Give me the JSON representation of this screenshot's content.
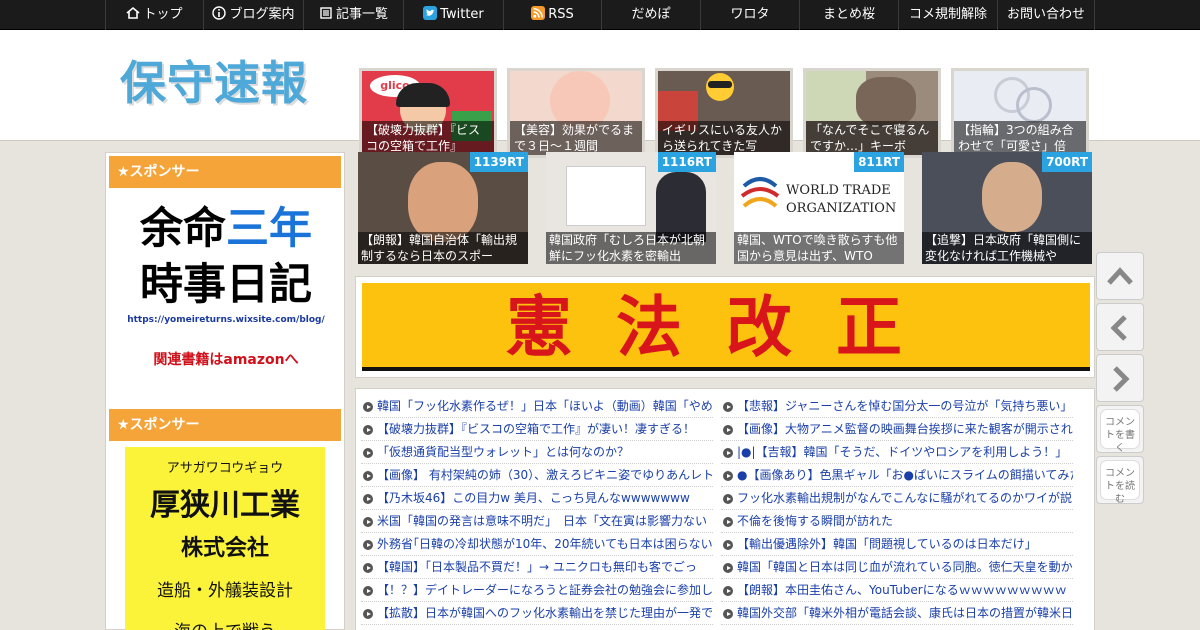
{
  "nav": {
    "items": [
      {
        "label": "トップ",
        "icon": "home-icon"
      },
      {
        "label": "ブログ案内",
        "icon": "info-icon"
      },
      {
        "label": "記事一覧",
        "icon": "list-icon"
      },
      {
        "label": "Twitter",
        "icon": "twitter-icon"
      },
      {
        "label": "RSS",
        "icon": "rss-icon"
      },
      {
        "label": "だめぽ",
        "icon": ""
      },
      {
        "label": "ワロタ",
        "icon": ""
      },
      {
        "label": "まとめ桜",
        "icon": ""
      },
      {
        "label": "コメ規制解除",
        "icon": ""
      },
      {
        "label": "お問い合わせ",
        "icon": ""
      }
    ]
  },
  "header": {
    "logo": "保守速報",
    "thumbs": [
      {
        "text": "【破壊力抜群】『ビスコの空箱で工作』",
        "extra": "glico"
      },
      {
        "text": "【美容】効果がでるまで３日～１週間",
        "extra": ""
      },
      {
        "text": "イギリスにいる友人から送られてきた写",
        "extra": ""
      },
      {
        "text": "「なんでそこで寝るんですか…」キーボ",
        "extra": ""
      },
      {
        "text": "【指輪】3つの組み合わせで「可愛さ」倍",
        "extra": ""
      }
    ]
  },
  "sidebar": {
    "sponsor_label_1": "★スポンサー",
    "ad1_line1_black": "余命",
    "ad1_line1_blue": "三年",
    "ad1_line2": "時事日記",
    "ad1_url": "https://yomeireturns.wixsite.com/blog/",
    "ad1_amazon": "関連書籍はamazonへ",
    "sponsor_label_2": "★スポンサー",
    "ad2_kana": "アサガワコウギョウ",
    "ad2_name": "厚狭川工業",
    "ad2_company": "株式会社",
    "ad2_service": "造船・外艤装設計",
    "ad2_tail": "海の上で戦う"
  },
  "rt_items": [
    {
      "count": "1139RT",
      "text": "【朗報】韓国自治体「輸出規制するなら日本のスポー"
    },
    {
      "count": "1116RT",
      "text": "韓国政府「むしろ日本が北朝鮮にフッ化水素を密輸出"
    },
    {
      "count": "811RT",
      "text": "韓国、WTOで喚き散らすも他国から意見は出ず、WTO",
      "logo_line1": "WORLD TRADE",
      "logo_line2": "ORGANIZATION"
    },
    {
      "count": "700RT",
      "text": "【追撃】日本政府「韓国側に変化なければ工作機械や"
    }
  ],
  "banner": {
    "text": "憲法改正"
  },
  "list_left": [
    "韓国「フッ化水素作るぜ！」日本「ほいよ（動画）韓国「やめ",
    "【破壊力抜群】『ビスコの空箱で工作』が凄い！凄すぎる！",
    "「仮想通貨配当型ウォレット」とは何なのか？",
    "【画像】 有村架純の姉（30）、激えろビキニ姿でゆりあんレト",
    "【乃木坂46】この目力w 美月、こっち見んなwwwwwww",
    "米国「韓国の発言は意味不明だ」　日本「文在寅は影響力ない",
    "外務省｢日韓の冷却状態が10年、20年続いても日本は困らない」",
    "【韓国】「日本製品不買だ！」→ ユニクロも無印も客でごっ",
    "【！？】デイトレーダーになろうと証券会社の勉強会に参加し",
    "【拡散】日本が韓国へのフッ化水素輸出を禁じた理由が一発で"
  ],
  "list_right": [
    "【悲報】ジャニーさんを悼む国分太一の号泣が「気持ち悪い」",
    "【画像】大物アニメ監督の映画舞台挨拶に来た観客が開示され",
    "|●|【吉報】韓国「そうだ、ドイツやロシアを利用しよう！」",
    "●【画像あり】色黒ギャル「お●ぱいにスライムの餌描いてみた",
    "フッ化水素輸出規制がなんでこんなに騒がれてるのかワイが説",
    "不倫を後悔する瞬間が訪れた",
    "【輸出優遇除外】韓国「問題視しているのは日本だけ」",
    "韓国「韓国と日本は同じ血が流れている同胞。徳仁天皇を動か",
    "【朗報】本田圭佑さん、YouTuberになるｗｗｗｗｗｗｗｗｗ",
    "韓国外交部「韓米外相が電話会談、康氏は日本の措置が韓米日"
  ],
  "float_buttons": [
    {
      "icon": "chevron-up-icon",
      "label": ""
    },
    {
      "icon": "chevron-left-icon",
      "label": ""
    },
    {
      "icon": "chevron-right-icon",
      "label": ""
    },
    {
      "icon": "",
      "label": "コメントを書く"
    },
    {
      "icon": "",
      "label": "コメントを読む"
    }
  ]
}
